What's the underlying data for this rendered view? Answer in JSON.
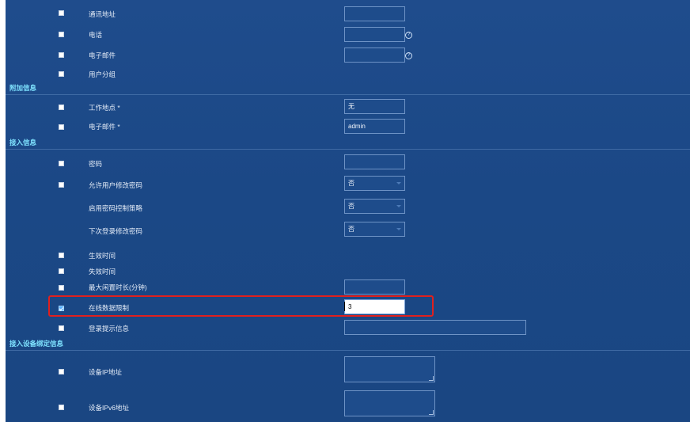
{
  "form": {
    "rows_top": [
      {
        "label": "通讯地址",
        "checked": false
      },
      {
        "label": "电话",
        "checked": false,
        "help": "?"
      },
      {
        "label": "电子邮件",
        "checked": false,
        "help": "?"
      },
      {
        "label": "用户分组",
        "checked": false
      }
    ],
    "section_extra": "附加信息",
    "extra_rows": [
      {
        "label": "工作地点 *",
        "value": "无"
      },
      {
        "label": "电子邮件 *",
        "value": "admin"
      }
    ],
    "section_access": "接入信息",
    "access_rows": [
      {
        "label": "密码",
        "value": ""
      },
      {
        "label": "允许用户修改密码",
        "value": "否"
      },
      {
        "label": "启用密码控制策略",
        "value": "否"
      },
      {
        "label": "下次登录修改密码",
        "value": "否"
      },
      {
        "label": "生效时间"
      },
      {
        "label": "失效时间"
      },
      {
        "label": "最大闲置时长(分钟)",
        "value": ""
      },
      {
        "label": "在线数据限制",
        "value": "3",
        "checked": true
      },
      {
        "label": "登录提示信息",
        "value": ""
      }
    ],
    "section_device": "接入设备绑定信息",
    "device_rows": [
      {
        "label": "设备IP地址",
        "value": ""
      },
      {
        "label": "设备IPv6地址",
        "value": ""
      }
    ]
  },
  "colors": {
    "panel": "#1b4886",
    "section_title": "#7fe3ff",
    "highlight": "#e0201e",
    "checked": "#5ab0ff"
  }
}
